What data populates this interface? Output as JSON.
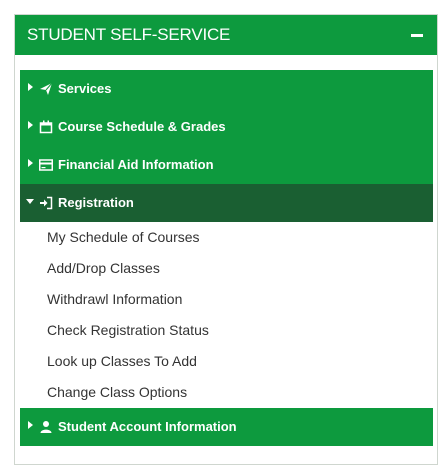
{
  "panel": {
    "title": "STUDENT SELF-SERVICE",
    "colors": {
      "header": "#0d9a3e",
      "expanded_row": "#1a5f32",
      "text": "#333333"
    }
  },
  "menu": [
    {
      "label": "Services",
      "icon": "paper-plane-icon",
      "expanded": false
    },
    {
      "label": "Course Schedule & Grades",
      "icon": "calendar-icon",
      "expanded": false
    },
    {
      "label": "Financial Aid Information",
      "icon": "credit-card-icon",
      "expanded": false
    },
    {
      "label": "Registration",
      "icon": "sign-in-icon",
      "expanded": true
    },
    {
      "label": "Student Account Information",
      "icon": "user-icon",
      "expanded": false
    }
  ],
  "registration_items": [
    "My Schedule of Courses",
    "Add/Drop Classes",
    "Withdrawl Information",
    "Check Registration Status",
    "Look up Classes To Add",
    "Change Class Options"
  ]
}
